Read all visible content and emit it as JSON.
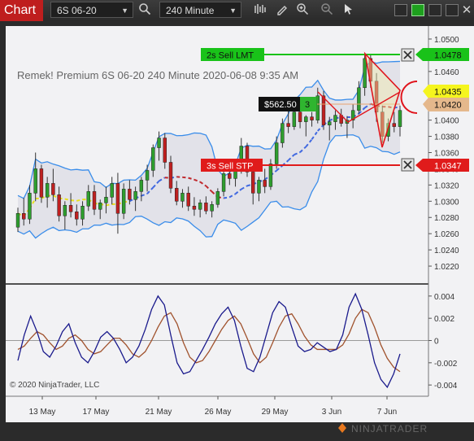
{
  "toolbar": {
    "title": "Chart",
    "instrument": "6S 06-20",
    "interval": "240 Minute"
  },
  "chart": {
    "header": "Remek!  Premium  6S 06-20  240 Minute  2020-06-08 9:35 AM",
    "copyright": "© 2020 NinjaTrader, LLC",
    "brand": "NINJATRADER",
    "orders": {
      "limit_label": "2s  Sell LMT",
      "limit_price": "1.0478",
      "stop_label": "3s  Sell STP",
      "stop_price": "1.0347",
      "pnl": "$562.50",
      "qty": "3"
    },
    "price_markers": {
      "yellow": "1.0435",
      "tan": "1.0420"
    },
    "price_axis": [
      "1.0500",
      "1.0480",
      "1.0460",
      "1.0440",
      "1.0420",
      "1.0400",
      "1.0380",
      "1.0360",
      "1.0340",
      "1.0320",
      "1.0300",
      "1.0280",
      "1.0260",
      "1.0240",
      "1.0220"
    ],
    "osc_axis": [
      "0.004",
      "0.002",
      "0",
      "-0.002",
      "-0.004"
    ],
    "date_axis": [
      "13 May",
      "17 May",
      "21 May",
      "26 May",
      "29 May",
      "3 Jun",
      "7 Jun"
    ],
    "colors": {
      "background": "#f2f2f4",
      "up_candle": "#2e9e2e",
      "down_candle": "#bf2020",
      "limit_order": "#19c219",
      "stop_order": "#e01b1b",
      "band": "#3a8dea",
      "osc_fast": "#1a1a8c",
      "osc_slow": "#a0522d"
    }
  },
  "chart_data": {
    "type": "candlestick",
    "title": "6S 06-20 240 Minute",
    "ylim": [
      1.0205,
      1.051
    ],
    "candles": [
      [
        1.0268,
        1.0292,
        1.0262,
        1.0285
      ],
      [
        1.0285,
        1.0304,
        1.027,
        1.0278
      ],
      [
        1.0278,
        1.032,
        1.0272,
        1.031
      ],
      [
        1.031,
        1.036,
        1.03,
        1.034
      ],
      [
        1.034,
        1.0345,
        1.0298,
        1.0305
      ],
      [
        1.0305,
        1.033,
        1.0292,
        1.0322
      ],
      [
        1.0322,
        1.034,
        1.03,
        1.0308
      ],
      [
        1.0308,
        1.0318,
        1.0275,
        1.0282
      ],
      [
        1.0282,
        1.03,
        1.0265,
        1.0295
      ],
      [
        1.0295,
        1.031,
        1.028,
        1.0287
      ],
      [
        1.0287,
        1.0296,
        1.027,
        1.0278
      ],
      [
        1.0278,
        1.03,
        1.027,
        1.0294
      ],
      [
        1.0294,
        1.032,
        1.0288,
        1.0312
      ],
      [
        1.0312,
        1.032,
        1.0283,
        1.029
      ],
      [
        1.029,
        1.0302,
        1.0278,
        1.0298
      ],
      [
        1.0298,
        1.0318,
        1.0285,
        1.0305
      ],
      [
        1.0305,
        1.033,
        1.0296,
        1.0322
      ],
      [
        1.0322,
        1.0335,
        1.026,
        1.0285
      ],
      [
        1.0285,
        1.0322,
        1.0278,
        1.0315
      ],
      [
        1.0315,
        1.0326,
        1.0296,
        1.0302
      ],
      [
        1.0302,
        1.0318,
        1.0288,
        1.0312
      ],
      [
        1.0312,
        1.033,
        1.03,
        1.0326
      ],
      [
        1.0326,
        1.0345,
        1.0312,
        1.0338
      ],
      [
        1.0338,
        1.037,
        1.033,
        1.0366
      ],
      [
        1.0366,
        1.0386,
        1.035,
        1.0378
      ],
      [
        1.0378,
        1.0384,
        1.034,
        1.0348
      ],
      [
        1.0348,
        1.0356,
        1.031,
        1.0316
      ],
      [
        1.0316,
        1.0325,
        1.0295,
        1.03
      ],
      [
        1.03,
        1.0315,
        1.0292,
        1.031
      ],
      [
        1.031,
        1.0318,
        1.0288,
        1.0294
      ],
      [
        1.0294,
        1.0305,
        1.0282,
        1.029
      ],
      [
        1.029,
        1.0302,
        1.028,
        1.0298
      ],
      [
        1.0298,
        1.0306,
        1.0284,
        1.0288
      ],
      [
        1.0288,
        1.03,
        1.028,
        1.0296
      ],
      [
        1.0296,
        1.0316,
        1.0292,
        1.0312
      ],
      [
        1.0312,
        1.034,
        1.0306,
        1.0334
      ],
      [
        1.0334,
        1.0346,
        1.032,
        1.0328
      ],
      [
        1.0328,
        1.0345,
        1.0318,
        1.034
      ],
      [
        1.034,
        1.0378,
        1.0334,
        1.0368
      ],
      [
        1.0368,
        1.0372,
        1.033,
        1.0336
      ],
      [
        1.0336,
        1.0342,
        1.0296,
        1.031
      ],
      [
        1.031,
        1.033,
        1.03,
        1.0326
      ],
      [
        1.0326,
        1.034,
        1.031,
        1.0318
      ],
      [
        1.0318,
        1.0352,
        1.0314,
        1.0346
      ],
      [
        1.0346,
        1.038,
        1.034,
        1.0372
      ],
      [
        1.0372,
        1.0402,
        1.0366,
        1.0396
      ],
      [
        1.0396,
        1.0412,
        1.0384,
        1.0392
      ],
      [
        1.0392,
        1.0418,
        1.0388,
        1.041
      ],
      [
        1.041,
        1.042,
        1.039,
        1.0398
      ],
      [
        1.0398,
        1.0406,
        1.038,
        1.0404
      ],
      [
        1.0404,
        1.041,
        1.0392,
        1.04
      ],
      [
        1.04,
        1.044,
        1.0396,
        1.043
      ],
      [
        1.043,
        1.0436,
        1.0388,
        1.0394
      ],
      [
        1.0394,
        1.0404,
        1.0375,
        1.0398
      ],
      [
        1.0398,
        1.0412,
        1.0388,
        1.0406
      ],
      [
        1.0406,
        1.0414,
        1.0392,
        1.0396
      ],
      [
        1.0396,
        1.0405,
        1.0378,
        1.04
      ],
      [
        1.04,
        1.042,
        1.039,
        1.0412
      ],
      [
        1.0412,
        1.0448,
        1.0408,
        1.044
      ],
      [
        1.044,
        1.0482,
        1.043,
        1.0476
      ],
      [
        1.0476,
        1.048,
        1.044,
        1.0448
      ],
      [
        1.0448,
        1.0458,
        1.0398,
        1.041
      ],
      [
        1.041,
        1.0418,
        1.0372,
        1.038
      ],
      [
        1.038,
        1.0402,
        1.0374,
        1.0396
      ],
      [
        1.0396,
        1.041,
        1.0385,
        1.0392
      ],
      [
        1.0392,
        1.0418,
        1.038,
        1.0412
      ]
    ],
    "osc_ylim": [
      -0.0045,
      0.0045
    ],
    "osc_fast": [
      -0.0018,
      0.0005,
      0.0022,
      0.0008,
      -0.001,
      -0.0015,
      -0.0005,
      0.0008,
      0.0015,
      -0.0002,
      -0.0015,
      -0.002,
      -0.001,
      0.0003,
      0.0008,
      0.0002,
      -0.0008,
      -0.002,
      -0.0015,
      -0.0005,
      0.001,
      0.0028,
      0.004,
      0.0032,
      0.0005,
      -0.002,
      -0.003,
      -0.0028,
      -0.0018,
      -0.0008,
      0.0003,
      0.0015,
      0.0024,
      0.003,
      0.0018,
      -0.0005,
      -0.0025,
      -0.0028,
      -0.0015,
      0.0005,
      0.0025,
      0.0035,
      0.003,
      0.0012,
      -0.0005,
      -0.001,
      -0.0008,
      -0.0002,
      -0.0006,
      -0.001,
      -0.0008,
      0.0005,
      0.003,
      0.0042,
      0.0028,
      0.0005,
      -0.002,
      -0.0035,
      -0.0042,
      -0.003,
      -0.0012
    ],
    "osc_slow": [
      -0.0008,
      -0.0005,
      0.0002,
      0.0008,
      0.0005,
      -0.0002,
      -0.0008,
      -0.0005,
      0.0002,
      0.0005,
      0.0,
      -0.0008,
      -0.0012,
      -0.001,
      -0.0004,
      0.0002,
      0.0002,
      -0.0004,
      -0.0012,
      -0.0015,
      -0.001,
      0.0,
      0.0012,
      0.0022,
      0.0025,
      0.0015,
      -0.0002,
      -0.0015,
      -0.002,
      -0.0018,
      -0.001,
      0.0,
      0.001,
      0.0018,
      0.0022,
      0.0015,
      0.0002,
      -0.0012,
      -0.002,
      -0.0015,
      -0.0002,
      0.0012,
      0.0022,
      0.0024,
      0.0015,
      0.0004,
      -0.0004,
      -0.0008,
      -0.0008,
      -0.0008,
      -0.0008,
      -0.0004,
      0.0006,
      0.002,
      0.0028,
      0.0025,
      0.0012,
      -0.0004,
      -0.0016,
      -0.0024,
      -0.0028
    ]
  }
}
